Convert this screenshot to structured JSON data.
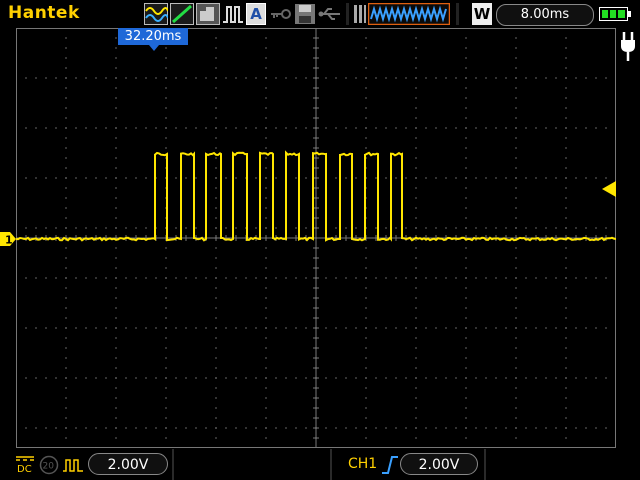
{
  "app": {
    "brand": "Hantek"
  },
  "toolbar": {
    "mode_letter": "A",
    "waveform_letter": "W",
    "timebase": "8.00ms"
  },
  "screen": {
    "trigger_position": "32.20ms",
    "channel_marker": "1"
  },
  "bottom": {
    "coupling": "DC",
    "bw_limit": "20",
    "ch1_scale": "2.00V",
    "trigger_source": "CH1",
    "trigger_level": "2.00V"
  },
  "colors": {
    "trace": "#ffe600",
    "brand": "#ffd000",
    "accent": "#1e68d8",
    "grid": "#5a5a5a"
  }
}
